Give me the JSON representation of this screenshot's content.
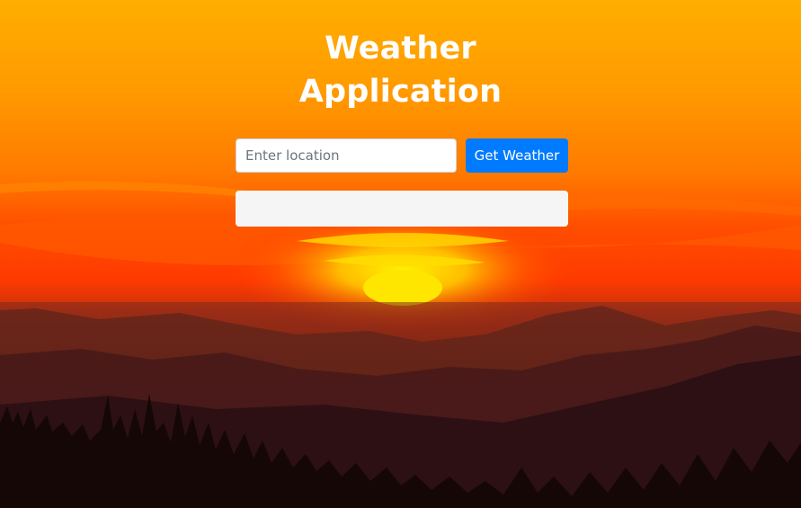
{
  "page": {
    "title_line1": "Weather",
    "title_line2": "Application"
  },
  "search": {
    "placeholder": "Enter location",
    "value": ""
  },
  "actions": {
    "get_weather_label": "Get Weather"
  },
  "result": {
    "text": ""
  },
  "theme": {
    "accent": "#007bff",
    "sky_top": "#ffab00",
    "sun": "#ffe600",
    "mountains": "#3a1512"
  },
  "background": {
    "icon": "sunset-over-mountains-photo"
  }
}
